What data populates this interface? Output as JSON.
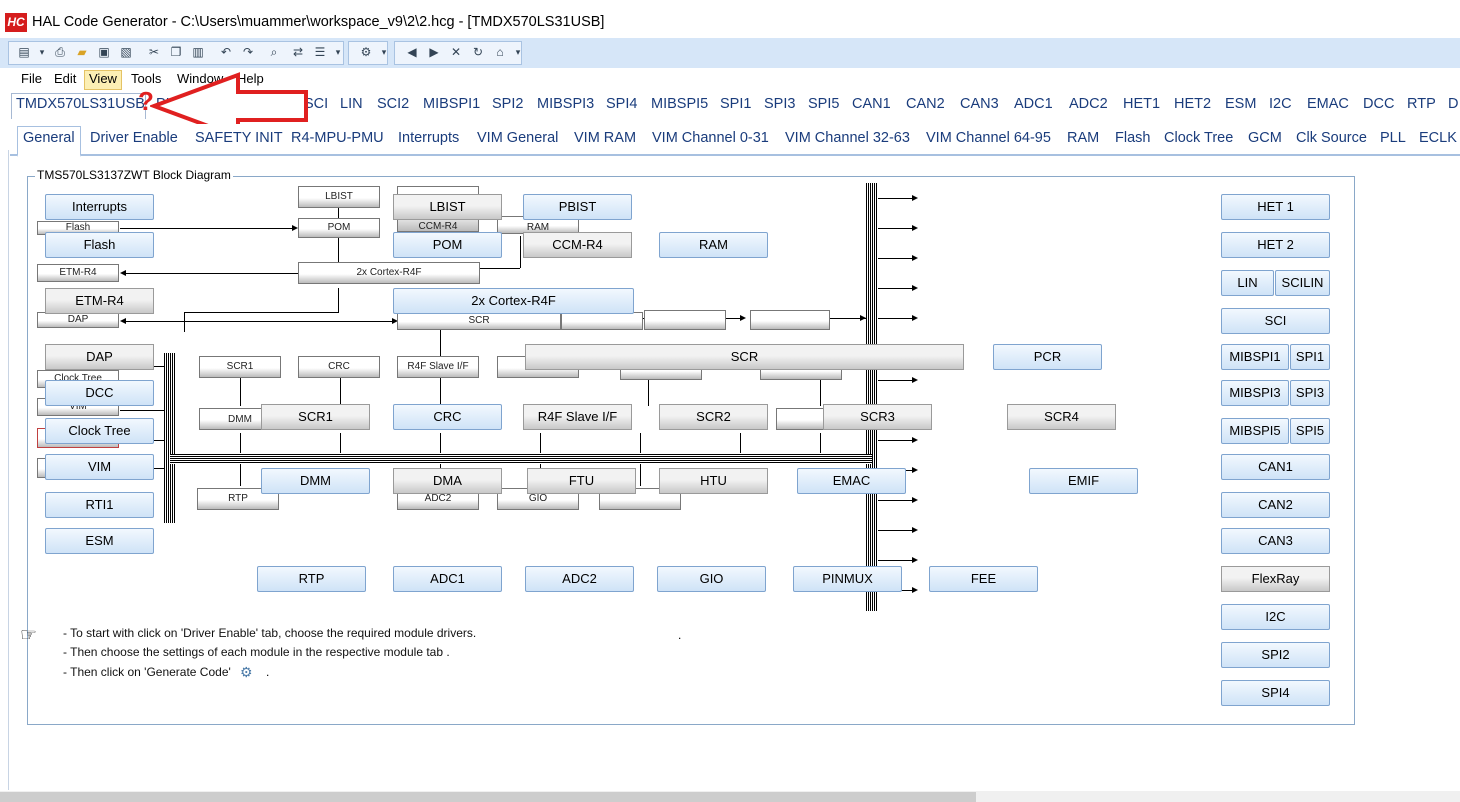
{
  "window": {
    "icon_text": "HC",
    "title": "HAL Code Generator - C:\\Users\\muammer\\workspace_v9\\2\\2.hcg - [TMDX570LS31USB]"
  },
  "menu": [
    "File",
    "Edit",
    "View",
    "Tools",
    "Window",
    "Help"
  ],
  "menu_selected": "View",
  "device_tabs": [
    "TMDX570LS31USB",
    "PIN",
    "SCI",
    "LIN",
    "SCI2",
    "MIBSPI1",
    "SPI2",
    "MIBSPI3",
    "SPI4",
    "MIBSPI5",
    "SPI1",
    "SPI3",
    "SPI5",
    "CAN1",
    "CAN2",
    "CAN3",
    "ADC1",
    "ADC2",
    "HET1",
    "HET2",
    "ESM",
    "I2C",
    "EMAC",
    "DCC",
    "RTP",
    "D"
  ],
  "annotation": {
    "question_mark": "?",
    "arrow_color": "#e02020"
  },
  "module_tabs": [
    "General",
    "Driver Enable",
    "SAFETY INIT",
    "R4-MPU-PMU",
    "Interrupts",
    "VIM General",
    "VIM RAM",
    "VIM Channel 0-31",
    "VIM Channel 32-63",
    "VIM Channel 64-95",
    "RAM",
    "Flash",
    "Clock Tree",
    "GCM",
    "Clk Source",
    "PLL",
    "ECLK"
  ],
  "diagram": {
    "title": "TMS570LS3137ZWT Block Diagram",
    "left_blocks": [
      "Interrupts",
      "Flash",
      "ETM-R4",
      "DAP",
      "DCC",
      "Clock Tree",
      "VIM",
      "RTI1",
      "ESM"
    ],
    "small_labels": [
      "Flash",
      "ETM-R4",
      "DAP",
      "Clock Tree",
      "VIM",
      "LBIST",
      "POM",
      "2x Cortex-R4F",
      "CCM-R4",
      "RAM",
      "SCR",
      "SCR1",
      "CRC",
      "R4F Slave I/F",
      "SCR2",
      "DMM",
      "RTP",
      "ADC2",
      "GIO"
    ],
    "top_blocks": [
      "LBIST",
      "PBIST",
      "POM",
      "CCM-R4",
      "RAM",
      "2x Cortex-R4F",
      "SCR",
      "PCR"
    ],
    "mid_blocks": [
      "SCR1",
      "CRC",
      "R4F Slave I/F",
      "SCR2",
      "SCR3",
      "SCR4"
    ],
    "lower_blocks": [
      "DMM",
      "DMA",
      "FTU",
      "HTU",
      "EMAC",
      "EMIF"
    ],
    "bottom_blocks": [
      "RTP",
      "ADC1",
      "ADC2",
      "GIO",
      "PINMUX",
      "FEE"
    ],
    "right_blocks": [
      "HET 1",
      "HET 2",
      "LIN",
      "SCILIN",
      "SCI",
      "MIBSPI1",
      "SPI1",
      "MIBSPI3",
      "SPI3",
      "MIBSPI5",
      "SPI5",
      "CAN1",
      "CAN2",
      "CAN3",
      "FlexRay",
      "I2C",
      "SPI2",
      "SPI4"
    ]
  },
  "instructions": [
    "- To start with click on 'Driver Enable' tab, choose the required module drivers.",
    "- Then choose the settings of each module in the respective module tab .",
    "- Then click on  'Generate Code'",
    "."
  ],
  "icons": [
    "app-icon",
    "new-icon",
    "open-icon",
    "save-icon",
    "cut-icon",
    "copy-icon",
    "paste-icon",
    "undo-icon",
    "redo-icon",
    "generate-code-icon",
    "back-icon",
    "forward-icon",
    "stop-icon",
    "refresh-icon",
    "home-icon",
    "pointing-hand-icon"
  ]
}
